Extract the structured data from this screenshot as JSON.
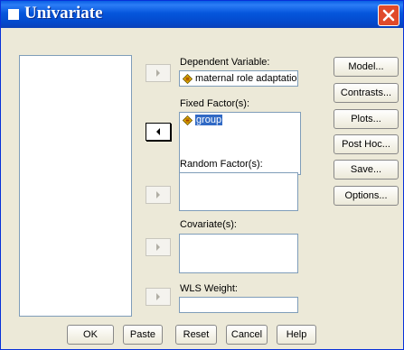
{
  "window": {
    "title": "Univariate"
  },
  "sections": {
    "dependent": {
      "label": "Dependent Variable:",
      "value": "maternal role adaptatio"
    },
    "fixed": {
      "label": "Fixed Factor(s):",
      "items": [
        "group"
      ]
    },
    "random": {
      "label": "Random Factor(s):"
    },
    "covariate": {
      "label": "Covariate(s):"
    },
    "wls": {
      "label": "WLS Weight:"
    }
  },
  "side_buttons": {
    "model": "Model...",
    "contrasts": "Contrasts...",
    "plots": "Plots...",
    "post_hoc": "Post Hoc...",
    "save": "Save...",
    "options": "Options..."
  },
  "bottom_buttons": {
    "ok": "OK",
    "paste": "Paste",
    "reset": "Reset",
    "cancel": "Cancel",
    "help": "Help"
  },
  "icons": {
    "title": "window-icon",
    "close": "close-icon",
    "variable": "scale-variable-icon",
    "arrow": "arrow-icon"
  },
  "colors": {
    "titlebar": "#0556dc",
    "close": "#e04a2a",
    "selection": "#316ac5",
    "dialog_bg": "#ece9d8"
  }
}
